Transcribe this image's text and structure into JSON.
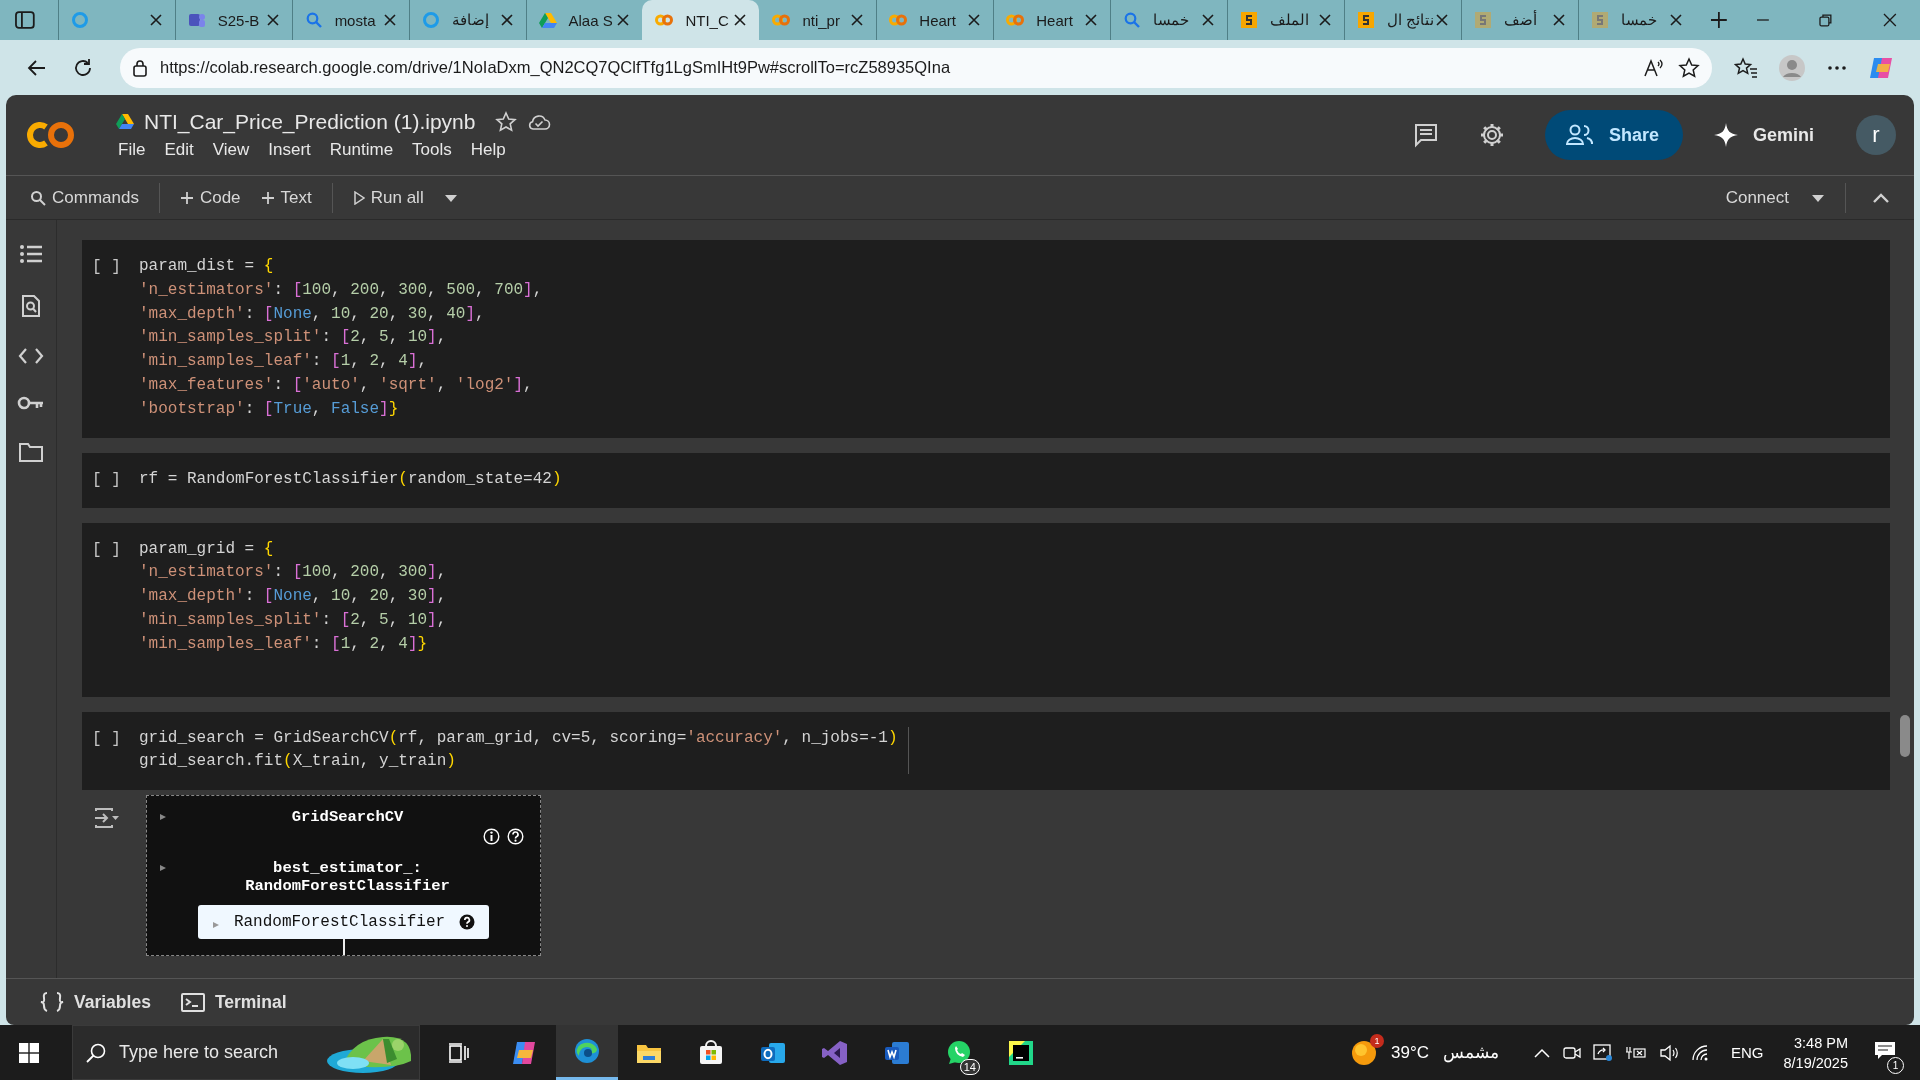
{
  "browser": {
    "tabs": [
      {
        "kind": "ring",
        "selected": false
      },
      {
        "kind": "teams",
        "title": "S25-B",
        "selected": false
      },
      {
        "kind": "search",
        "title": "mosta",
        "selected": false
      },
      {
        "kind": "ring",
        "title": "إضافة",
        "selected": false
      },
      {
        "kind": "drive",
        "title": "Alaa S",
        "selected": false
      },
      {
        "kind": "colab",
        "title": "NTI_C",
        "selected": true
      },
      {
        "kind": "colab",
        "title": "nti_pr",
        "selected": false
      },
      {
        "kind": "colab",
        "title": "Heart",
        "selected": false
      },
      {
        "kind": "colab",
        "title": "Heart",
        "selected": false
      },
      {
        "kind": "search",
        "title": "خمسا",
        "selected": false
      },
      {
        "kind": "five",
        "title": "الملف",
        "selected": false
      },
      {
        "kind": "five",
        "title": "نتائج ال",
        "selected": false
      },
      {
        "kind": "fivedim",
        "title": "أضف",
        "selected": false
      },
      {
        "kind": "fivedim",
        "title": "خمسا",
        "selected": false
      }
    ],
    "url": "https://colab.research.google.com/drive/1NoIaDxm_QN2CQ7QClfTfg1LgSmIHt9Pw#scrollTo=rcZ58935QIna"
  },
  "notebook": {
    "title": "NTI_Car_Price_Prediction (1).ipynb",
    "menu": [
      "File",
      "Edit",
      "View",
      "Insert",
      "Runtime",
      "Tools",
      "Help"
    ],
    "share": "Share",
    "gemini": "Gemini",
    "avatar": "r",
    "toolbar": {
      "commands": "Commands",
      "add_code": "Code",
      "add_text": "Text",
      "run_all": "Run all",
      "connect": "Connect"
    }
  },
  "cells": [
    {
      "run_marker": "[ ]",
      "lines": [
        "param_dist = {",
        "'n_estimators': [100, 200, 300, 500, 700],",
        "'max_depth': [None, 10, 20, 30, 40],",
        "'min_samples_split': [2, 5, 10],",
        "'min_samples_leaf': [1, 2, 4],",
        "'max_features': ['auto', 'sqrt', 'log2'],",
        "'bootstrap': [True, False]}"
      ]
    },
    {
      "run_marker": "[ ]",
      "lines": [
        "rf = RandomForestClassifier(random_state=42)"
      ]
    },
    {
      "run_marker": "[ ]",
      "lines": [
        "param_grid = {",
        "'n_estimators': [100, 200, 300],",
        "'max_depth': [None, 10, 20, 30],",
        "'min_samples_split': [2, 5, 10],",
        "'min_samples_leaf': [1, 2, 4]}"
      ]
    },
    {
      "run_marker": "[ ]",
      "lines": [
        "grid_search = GridSearchCV(rf, param_grid, cv=5, scoring='accuracy', n_jobs=-1)",
        "grid_search.fit(X_train, y_train)"
      ],
      "output": {
        "title": "GridSearchCV",
        "estimator_label": "best_estimator_:",
        "estimator_class": "RandomForestClassifier",
        "leaf": "RandomForestClassifier"
      }
    }
  ],
  "bottom_bar": [
    "Variables",
    "Terminal"
  ],
  "taskbar": {
    "search_placeholder": "Type here to search",
    "apps": [
      {
        "kind": "copilot",
        "active": false
      },
      {
        "kind": "edge",
        "active": true
      },
      {
        "kind": "folder",
        "active": false
      },
      {
        "kind": "store",
        "active": false
      },
      {
        "kind": "outlook",
        "active": false
      },
      {
        "kind": "vs",
        "active": false
      },
      {
        "kind": "word",
        "active": false
      },
      {
        "kind": "whatsapp",
        "active": false,
        "badge": "14"
      },
      {
        "kind": "pycharm",
        "active": false
      }
    ],
    "weather_badge": "1",
    "temperature": "39°C",
    "weather": "مشمس",
    "language": "ENG",
    "time": "3:48 PM",
    "date": "8/19/2025",
    "notifications": "1"
  }
}
